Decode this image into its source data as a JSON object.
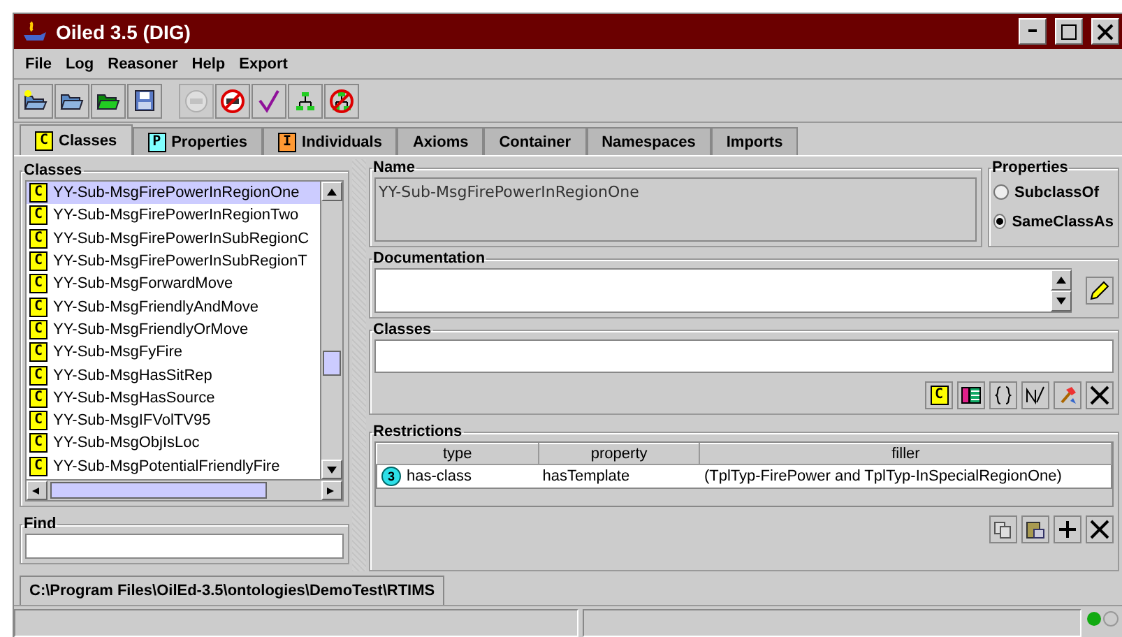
{
  "window": {
    "title": "Oiled 3.5 (DIG)"
  },
  "menu": [
    "File",
    "Log",
    "Reasoner",
    "Help",
    "Export"
  ],
  "toolbar": [
    {
      "disabled": false
    },
    {
      "disabled": false
    },
    {
      "disabled": false
    },
    {
      "disabled": false
    },
    {
      "disabled": true
    },
    {
      "disabled": false
    },
    {
      "disabled": false
    },
    {
      "disabled": false
    },
    {
      "disabled": false
    }
  ],
  "tabs": [
    {
      "badge": "C",
      "color": "#ffff00",
      "label": "Classes",
      "selected": true
    },
    {
      "badge": "P",
      "color": "#80ffff",
      "label": "Properties",
      "selected": false
    },
    {
      "badge": "I",
      "color": "#ff9933",
      "label": "Individuals",
      "selected": false
    },
    {
      "label": "Axioms",
      "selected": false
    },
    {
      "label": "Container",
      "selected": false
    },
    {
      "label": "Namespaces",
      "selected": false
    },
    {
      "label": "Imports",
      "selected": false
    }
  ],
  "classes_panel": {
    "title": "Classes",
    "items": [
      {
        "badge": "C",
        "name": "YY-Sub-MsgFirePowerInRegionOne",
        "selected": true
      },
      {
        "badge": "C",
        "name": "YY-Sub-MsgFirePowerInRegionTwo",
        "selected": false
      },
      {
        "badge": "C",
        "name": "YY-Sub-MsgFirePowerInSubRegionC",
        "selected": false
      },
      {
        "badge": "C",
        "name": "YY-Sub-MsgFirePowerInSubRegionT",
        "selected": false
      },
      {
        "badge": "C",
        "name": "YY-Sub-MsgForwardMove",
        "selected": false
      },
      {
        "badge": "C",
        "name": "YY-Sub-MsgFriendlyAndMove",
        "selected": false
      },
      {
        "badge": "C",
        "name": "YY-Sub-MsgFriendlyOrMove",
        "selected": false
      },
      {
        "badge": "C",
        "name": "YY-Sub-MsgFyFire",
        "selected": false
      },
      {
        "badge": "C",
        "name": "YY-Sub-MsgHasSitRep",
        "selected": false
      },
      {
        "badge": "C",
        "name": "YY-Sub-MsgHasSource",
        "selected": false
      },
      {
        "badge": "C",
        "name": "YY-Sub-MsgIFVolTV95",
        "selected": false
      },
      {
        "badge": "C",
        "name": "YY-Sub-MsgObjIsLoc",
        "selected": false
      },
      {
        "badge": "C",
        "name": "YY-Sub-MsgPotentialFriendlyFire",
        "selected": false
      }
    ]
  },
  "find": {
    "title": "Find"
  },
  "name_group": {
    "title": "Name",
    "value": "YY-Sub-MsgFirePowerInRegionOne"
  },
  "properties": {
    "title": "Properties",
    "options": [
      {
        "label": "SubclassOf",
        "selected": false
      },
      {
        "label": "SameClassAs",
        "selected": true
      }
    ]
  },
  "documentation": {
    "title": "Documentation"
  },
  "classes_group": {
    "title": "Classes",
    "add_badge": "C"
  },
  "restrictions": {
    "title": "Restrictions",
    "columns": [
      "type",
      "property",
      "filler"
    ],
    "rows": [
      {
        "badge": "3",
        "type": "has-class",
        "property": "hasTemplate",
        "filler": "(TplTyp-FirePower and TplTyp-InSpecialRegionOne)"
      }
    ]
  },
  "file_tab": {
    "label": "C:\\Program Files\\OilEd-3.5\\ontologies\\DemoTest\\RTIMS"
  }
}
